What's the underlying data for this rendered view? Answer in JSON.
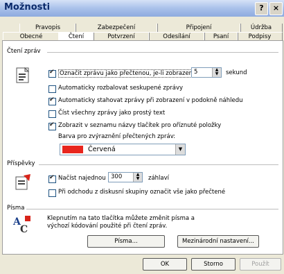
{
  "window": {
    "title": "Možnosti",
    "help_label": "?",
    "close_label": "×"
  },
  "tabs_row1": [
    "Pravopis",
    "Zabezpečení",
    "Připojení",
    "Údržba"
  ],
  "tabs_row2": [
    "Obecné",
    "Čtení",
    "Potvrzení",
    "Odesílání",
    "Psaní",
    "Podpisy"
  ],
  "active_tab": "Čtení",
  "reading": {
    "section": "Čtení zpráv",
    "mark_read": {
      "checked": true,
      "label": "Označit zprávu jako přečtenou, je-li zobrazena",
      "value": "5",
      "unit": "sekund"
    },
    "auto_expand": {
      "checked": false,
      "label": "Automaticky rozbalovat seskupené zprávy"
    },
    "auto_download": {
      "checked": true,
      "label": "Automaticky stahovat zprávy při zobrazení v podokně náhledu"
    },
    "read_plain": {
      "checked": false,
      "label": "Číst všechny zprávy jako prostý text"
    },
    "show_tooltips": {
      "checked": true,
      "label": "Zobrazit v seznamu názvy tlačítek pro oříznuté položky"
    },
    "highlight_label": "Barva pro zvýraznění přečtených zpráv:",
    "highlight_color": "Červená",
    "highlight_hex": "#e8261e"
  },
  "posts": {
    "section": "Příspěvky",
    "fetch": {
      "checked": true,
      "label": "Načíst najednou",
      "value": "300",
      "unit": "záhlaví"
    },
    "mark_on_leave": {
      "checked": false,
      "label": "Při odchodu z diskusní skupiny označit vše jako přečtené"
    }
  },
  "fonts": {
    "section": "Písma",
    "text": [
      "Klepnutím na tato tlačítka můžete změnit písma a",
      "výchozí kódování použité při čtení zpráv."
    ],
    "fonts_button": "Písma...",
    "intl_button": "Mezinárodní nastavení..."
  },
  "footer": {
    "ok": "OK",
    "cancel": "Storno",
    "apply": "Použít"
  }
}
